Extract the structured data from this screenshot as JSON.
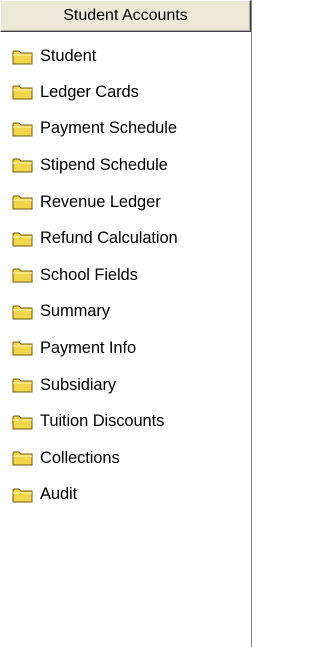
{
  "panel": {
    "header": "Student Accounts",
    "items": [
      {
        "label": "Student",
        "icon": "folder-icon"
      },
      {
        "label": "Ledger Cards",
        "icon": "folder-icon"
      },
      {
        "label": "Payment Schedule",
        "icon": "folder-icon"
      },
      {
        "label": "Stipend Schedule",
        "icon": "folder-icon"
      },
      {
        "label": "Revenue Ledger",
        "icon": "folder-icon"
      },
      {
        "label": "Refund Calculation",
        "icon": "folder-icon"
      },
      {
        "label": "School Fields",
        "icon": "folder-icon"
      },
      {
        "label": "Summary",
        "icon": "folder-icon"
      },
      {
        "label": "Payment Info",
        "icon": "folder-icon"
      },
      {
        "label": "Subsidiary",
        "icon": "folder-icon"
      },
      {
        "label": "Tuition Discounts",
        "icon": "folder-icon"
      },
      {
        "label": "Collections",
        "icon": "folder-icon"
      },
      {
        "label": "Audit",
        "icon": "folder-icon"
      }
    ]
  },
  "colors": {
    "header_bg": "#ece9d8",
    "folder_fill": "#f2d64a",
    "folder_outline": "#6b5a14"
  }
}
